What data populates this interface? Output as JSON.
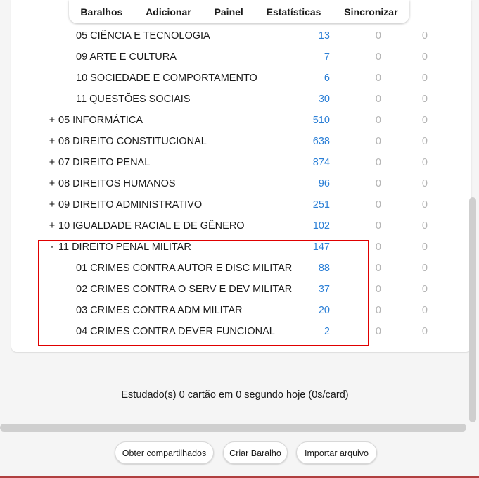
{
  "nav": {
    "items": [
      "Baralhos",
      "Adicionar",
      "Painel",
      "Estatísticas",
      "Sincronizar"
    ]
  },
  "decks": [
    {
      "toggle": "",
      "name": "05 CIÊNCIA E TECNOLOGIA",
      "new": "13",
      "learn": "0",
      "due": "0",
      "level": 2
    },
    {
      "toggle": "",
      "name": "09 ARTE E CULTURA",
      "new": "7",
      "learn": "0",
      "due": "0",
      "level": 2
    },
    {
      "toggle": "",
      "name": "10 SOCIEDADE E COMPORTAMENTO",
      "new": "6",
      "learn": "0",
      "due": "0",
      "level": 2
    },
    {
      "toggle": "",
      "name": "11 QUESTÕES SOCIAIS",
      "new": "30",
      "learn": "0",
      "due": "0",
      "level": 2
    },
    {
      "toggle": "+",
      "name": "05 INFORMÁTICA",
      "new": "510",
      "learn": "0",
      "due": "0",
      "level": 1
    },
    {
      "toggle": "+",
      "name": "06 DIREITO CONSTITUCIONAL",
      "new": "638",
      "learn": "0",
      "due": "0",
      "level": 1
    },
    {
      "toggle": "+",
      "name": "07 DIREITO PENAL",
      "new": "874",
      "learn": "0",
      "due": "0",
      "level": 1
    },
    {
      "toggle": "+",
      "name": "08 DIREITOS HUMANOS",
      "new": "96",
      "learn": "0",
      "due": "0",
      "level": 1
    },
    {
      "toggle": "+",
      "name": "09 DIREITO ADMINISTRATIVO",
      "new": "251",
      "learn": "0",
      "due": "0",
      "level": 1
    },
    {
      "toggle": "+",
      "name": "10 IGUALDADE RACIAL E DE GÊNERO",
      "new": "102",
      "learn": "0",
      "due": "0",
      "level": 1
    },
    {
      "toggle": "-",
      "name": "11 DIREITO PENAL MILITAR",
      "new": "147",
      "learn": "0",
      "due": "0",
      "level": 1
    },
    {
      "toggle": "",
      "name": "01 CRIMES CONTRA AUTOR E DISC MILITAR",
      "new": "88",
      "learn": "0",
      "due": "0",
      "level": 2
    },
    {
      "toggle": "",
      "name": "02 CRIMES CONTRA O SERV E DEV MILITAR",
      "new": "37",
      "learn": "0",
      "due": "0",
      "level": 2
    },
    {
      "toggle": "",
      "name": "03 CRIMES CONTRA ADM MILITAR",
      "new": "20",
      "learn": "0",
      "due": "0",
      "level": 2
    },
    {
      "toggle": "",
      "name": "04 CRIMES CONTRA DEVER FUNCIONAL",
      "new": "2",
      "learn": "0",
      "due": "0",
      "level": 2
    }
  ],
  "stats_text": "Estudado(s) 0 cartão em 0 segundo hoje (0s/card)",
  "buttons": {
    "shared": "Obter compartilhados",
    "create": "Criar Baralho",
    "import": "Importar arquivo"
  },
  "colors": {
    "new_count": "#2b7fd6",
    "zero_count": "#b3b3b3",
    "highlight": "#e00000"
  }
}
